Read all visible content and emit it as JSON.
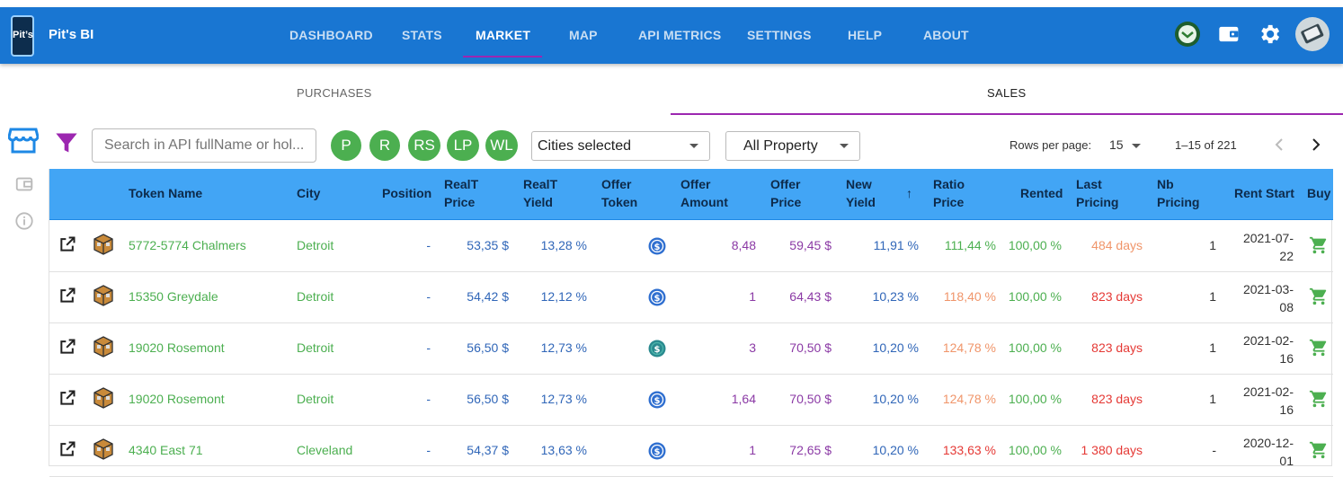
{
  "app": {
    "logo_text": "Pit’s",
    "brand": "Pit's BI",
    "nav": [
      "DASHBOARD",
      "STATS",
      "MARKET",
      "MAP",
      "API METRICS",
      "SETTINGS",
      "HELP",
      "ABOUT"
    ],
    "active_nav": "MARKET",
    "icons": [
      "wallet-token-icon",
      "wallet-icon",
      "gear-icon",
      "avatar"
    ]
  },
  "tabs": {
    "purchases": "PURCHASES",
    "sales": "SALES",
    "active": "SALES"
  },
  "toolbar": {
    "search_placeholder": "Search in API fullName or hol...",
    "chips": [
      "P",
      "R",
      "RS",
      "LP",
      "WL"
    ],
    "cities_select": "Cities selected",
    "property_select": "All Property",
    "rows_per_page_label": "Rows per page:",
    "rows_per_page_value": "15",
    "range": "1–15 of 221"
  },
  "table": {
    "headers": {
      "token_name": "Token Name",
      "city": "City",
      "position": "Position",
      "realt_price": [
        "RealT",
        "Price"
      ],
      "realt_yield": [
        "RealT",
        "Yield"
      ],
      "offer_token": [
        "Offer",
        "Token"
      ],
      "offer_amount": [
        "Offer",
        "Amount"
      ],
      "offer_price": [
        "Offer",
        "Price"
      ],
      "new_yield": [
        "New",
        "Yield"
      ],
      "sort_arrow": "↑",
      "ratio_price": [
        "Ratio",
        "Price"
      ],
      "rented": "Rented",
      "last_pricing": [
        "Last",
        "Pricing"
      ],
      "nb_pricing": [
        "Nb",
        "Pricing"
      ],
      "rent_start": "Rent Start",
      "buy": "Buy"
    },
    "rows": [
      {
        "token_name": "5772-5774 Chalmers",
        "city": "Detroit",
        "position": "-",
        "realt_price": "53,35 $",
        "realt_yield": "13,28 %",
        "offer_amount": "8,48",
        "offer_price": "59,45 $",
        "new_yield": "11,91 %",
        "ratio_price": "111,44 %",
        "ratio_color": "green",
        "rented": "100,00 %",
        "last_pricing": "484 days",
        "last_color": "orange",
        "nb_pricing": "1",
        "rent_start": [
          "2021-07-",
          "22"
        ],
        "token_style": "blue"
      },
      {
        "token_name": "15350 Greydale",
        "city": "Detroit",
        "position": "-",
        "realt_price": "54,42 $",
        "realt_yield": "12,12 %",
        "offer_amount": "1",
        "offer_price": "64,43 $",
        "new_yield": "10,23 %",
        "ratio_price": "118,40 %",
        "ratio_color": "orange",
        "rented": "100,00 %",
        "last_pricing": "823 days",
        "last_color": "red",
        "nb_pricing": "1",
        "rent_start": [
          "2021-03-",
          "08"
        ],
        "token_style": "blue"
      },
      {
        "token_name": "19020 Rosemont",
        "city": "Detroit",
        "position": "-",
        "realt_price": "56,50 $",
        "realt_yield": "12,73 %",
        "offer_amount": "3",
        "offer_price": "70,50 $",
        "new_yield": "10,20 %",
        "ratio_price": "124,78 %",
        "ratio_color": "orange",
        "rented": "100,00 %",
        "last_pricing": "823 days",
        "last_color": "red",
        "nb_pricing": "1",
        "rent_start": [
          "2021-02-",
          "16"
        ],
        "token_style": "teal"
      },
      {
        "token_name": "19020 Rosemont",
        "city": "Detroit",
        "position": "-",
        "realt_price": "56,50 $",
        "realt_yield": "12,73 %",
        "offer_amount": "1,64",
        "offer_price": "70,50 $",
        "new_yield": "10,20 %",
        "ratio_price": "124,78 %",
        "ratio_color": "orange",
        "rented": "100,00 %",
        "last_pricing": "823 days",
        "last_color": "red",
        "nb_pricing": "1",
        "rent_start": [
          "2021-02-",
          "16"
        ],
        "token_style": "blue"
      },
      {
        "token_name": "4340 East 71",
        "city": "Cleveland",
        "position": "-",
        "realt_price": "54,37 $",
        "realt_yield": "13,63 %",
        "offer_amount": "1",
        "offer_price": "72,65 $",
        "new_yield": "10,20 %",
        "ratio_price": "133,63 %",
        "ratio_color": "red",
        "rented": "100,00 %",
        "last_pricing": "1 380 days",
        "last_color": "red",
        "nb_pricing": "-",
        "rent_start": [
          "2020-12-",
          "01"
        ],
        "token_style": "blue"
      }
    ]
  },
  "colors": {
    "appbar": "#1976d2",
    "accent": "#9c27b0",
    "table_header": "#42a5f5",
    "chip": "#4caf50"
  }
}
